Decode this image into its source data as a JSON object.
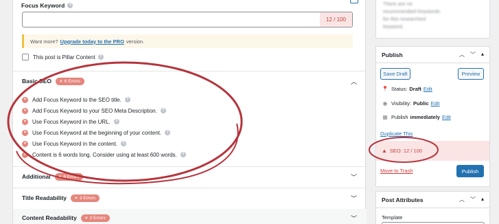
{
  "focus_keyword": {
    "title": "Focus Keyword",
    "value": "",
    "count": "12 / 100"
  },
  "notice": {
    "prefix": "Want more?",
    "link": "Upgrade today to the PRO",
    "suffix": "version."
  },
  "pillar": {
    "label": "This post is Pillar Content"
  },
  "sections": {
    "basic_seo": {
      "title": "Basic SEO",
      "badge": "6 Errors"
    },
    "additional": {
      "title": "Additional",
      "badge": "6 Errors"
    },
    "title_readability": {
      "title": "Title Readability",
      "badge": "3 Errors"
    },
    "content_readability": {
      "title": "Content Readability",
      "badge": "2 Errors"
    }
  },
  "checks": [
    "Add Focus Keyword to the SEO title.",
    "Add Focus Keyword to your SEO Meta Description.",
    "Use Focus Keyword in the URL.",
    "Use Focus Keyword at the beginning of your content.",
    "Use Focus Keyword in the content.",
    "Content is 6 words long. Consider using at least 600 words."
  ],
  "side_note": "There are no recommended Keywords for this researched keyword.",
  "publish": {
    "title": "Publish",
    "save_draft": "Save Draft",
    "preview": "Preview",
    "status_label": "Status:",
    "status_value": "Draft",
    "visibility_label": "Visibility:",
    "visibility_value": "Public",
    "publish_label": "Publish",
    "publish_value": "immediately",
    "edit": "Edit",
    "duplicate": "Duplicate This",
    "seo_score": "SEO: 12 / 100",
    "trash": "Move to Trash",
    "publish_button": "Publish"
  },
  "attributes": {
    "title": "Post Attributes",
    "template": "Template"
  },
  "colors": {
    "accent": "#2271b1",
    "error": "#e5867c",
    "score_bg": "#fbe5e4",
    "annotation": "#b5343c"
  }
}
